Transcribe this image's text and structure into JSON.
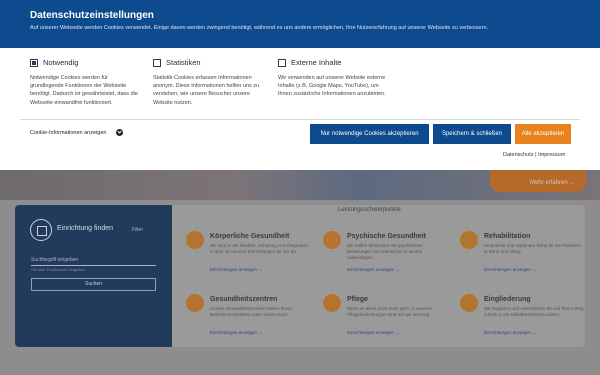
{
  "banner": {
    "title": "Datenschutzeinstellungen",
    "subtitle": "Auf unserer Webseite werden Cookies verwendet. Einige davon werden zwingend benötigt, während es uns andere ermöglichen, Ihre Nutzererfahrung auf unserer Webseite zu verbessern.",
    "categories": [
      {
        "label": "Notwendig",
        "checked": true,
        "description": "Notwendige Cookies werden für grundlegende Funktionen der Webseite benötigt. Dadurch ist gewährleistet, dass die Webseite einwandfrei funktioniert."
      },
      {
        "label": "Statistiken",
        "checked": false,
        "description": "Statistik-Cookies erfassen Informationen anonym. Diese Informationen helfen uns zu verstehen, wie unsere Besucher unsere Website nutzen."
      },
      {
        "label": "Externe Inhalte",
        "checked": false,
        "description": "Wir verwenden auf unserer Website externe Inhalte (z.B. Google Maps, YouTube), um Ihnen zusätzliche Informationen anzubieten."
      }
    ],
    "info_toggle": "Cookie-Informationen anzeigen",
    "buttons": {
      "necessary": "Nur notwendige Cookies akzeptieren",
      "save": "Speichern & schließen",
      "accept_all": "Alle akzeptieren"
    },
    "links": {
      "privacy": "Datenschutz",
      "separator": "|",
      "imprint": "Impressum"
    }
  },
  "background": {
    "hero_more": "Mehr erfahren →",
    "finder": {
      "title": "Einrichtung finden",
      "filter": "Filter",
      "input_placeholder": "Suchbegriff eingeben",
      "hint": "Ort oder Postleitzahl eingeben",
      "button": "Suchen"
    },
    "services_title": "Leistungsschwerpunkte",
    "services": [
      {
        "name": "Körperliche Gesundheit",
        "text": "Wir sind in der Medizin, Schulung und Integration in über 40 unserer Einrichtungen für Sie da.",
        "link": "Einrichtungen anzeigen →"
      },
      {
        "name": "Psychische Gesundheit",
        "text": "Wir helfen Menschen mit psychischen Belastungen und Menschen in akuten Lebenslagen.",
        "link": "Einrichtungen anzeigen →"
      },
      {
        "name": "Rehabilitation",
        "text": "Ambulante und stationäre Reha für die Rückkehr in Beruf und Alltag.",
        "link": "Einrichtungen anzeigen →"
      },
      {
        "name": "Gesundheitszentren",
        "text": "Unsere Gesundheitszentren bieten Ihnen ärztliche Kompetenz unter einem Dach.",
        "link": "Einrichtungen anzeigen →"
      },
      {
        "name": "Pflege",
        "text": "Wenn es allein nicht mehr geht: in unseren Pflegeeinrichtungen sind Sie gut versorgt.",
        "link": "Einrichtungen anzeigen →"
      },
      {
        "name": "Eingliederung",
        "text": "Wir begleiten und unterstützen Sie auf Ihrem Weg zurück in ein selbstbestimmtes Leben.",
        "link": "Einrichtungen anzeigen →"
      }
    ]
  },
  "colors": {
    "primary": "#0d4a8e",
    "accent": "#e8821e",
    "service_icon": "#b5742e"
  },
  "icons": {
    "info_toggle": "chevron-down-icon",
    "finder": "building-icon"
  }
}
